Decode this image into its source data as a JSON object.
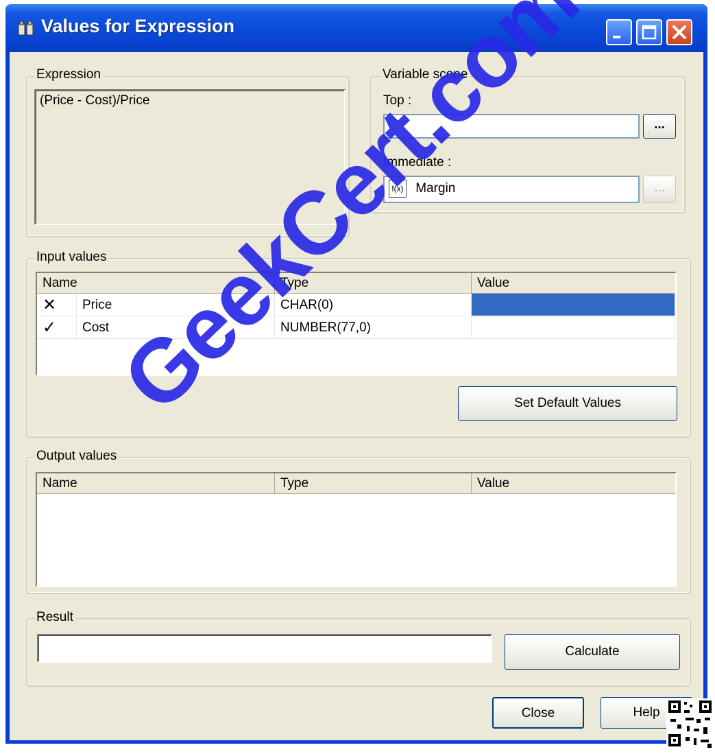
{
  "window": {
    "title": "Values for Expression",
    "accent_color": "#0a40cf"
  },
  "expression": {
    "group_label": "Expression",
    "text": "(Price - Cost)/Price"
  },
  "variable_scope": {
    "group_label": "Variable scope",
    "top_label": "Top :",
    "top_value": "",
    "top_browse": "...",
    "immediate_label": "Immediate :",
    "immediate_value": "Margin",
    "immediate_icon": "function-icon",
    "immediate_browse": "..."
  },
  "input_values": {
    "group_label": "Input values",
    "columns": [
      "Name",
      "Type",
      "Value"
    ],
    "rows": [
      {
        "status_icon": "x-mark-icon",
        "status_glyph": "✕",
        "name": "Price",
        "type": "CHAR(0)",
        "value": ""
      },
      {
        "status_icon": "check-mark-icon",
        "status_glyph": "✓",
        "name": "Cost",
        "type": "NUMBER(77,0)",
        "value": ""
      }
    ],
    "selected_color": "#316ac5",
    "set_default_button": "Set Default Values"
  },
  "output_values": {
    "group_label": "Output values",
    "columns": [
      "Name",
      "Type",
      "Value"
    ]
  },
  "result": {
    "group_label": "Result",
    "value": "",
    "calculate_button": "Calculate"
  },
  "footer": {
    "close_button": "Close",
    "help_button": "Help"
  },
  "watermark": "GeekCert.com"
}
